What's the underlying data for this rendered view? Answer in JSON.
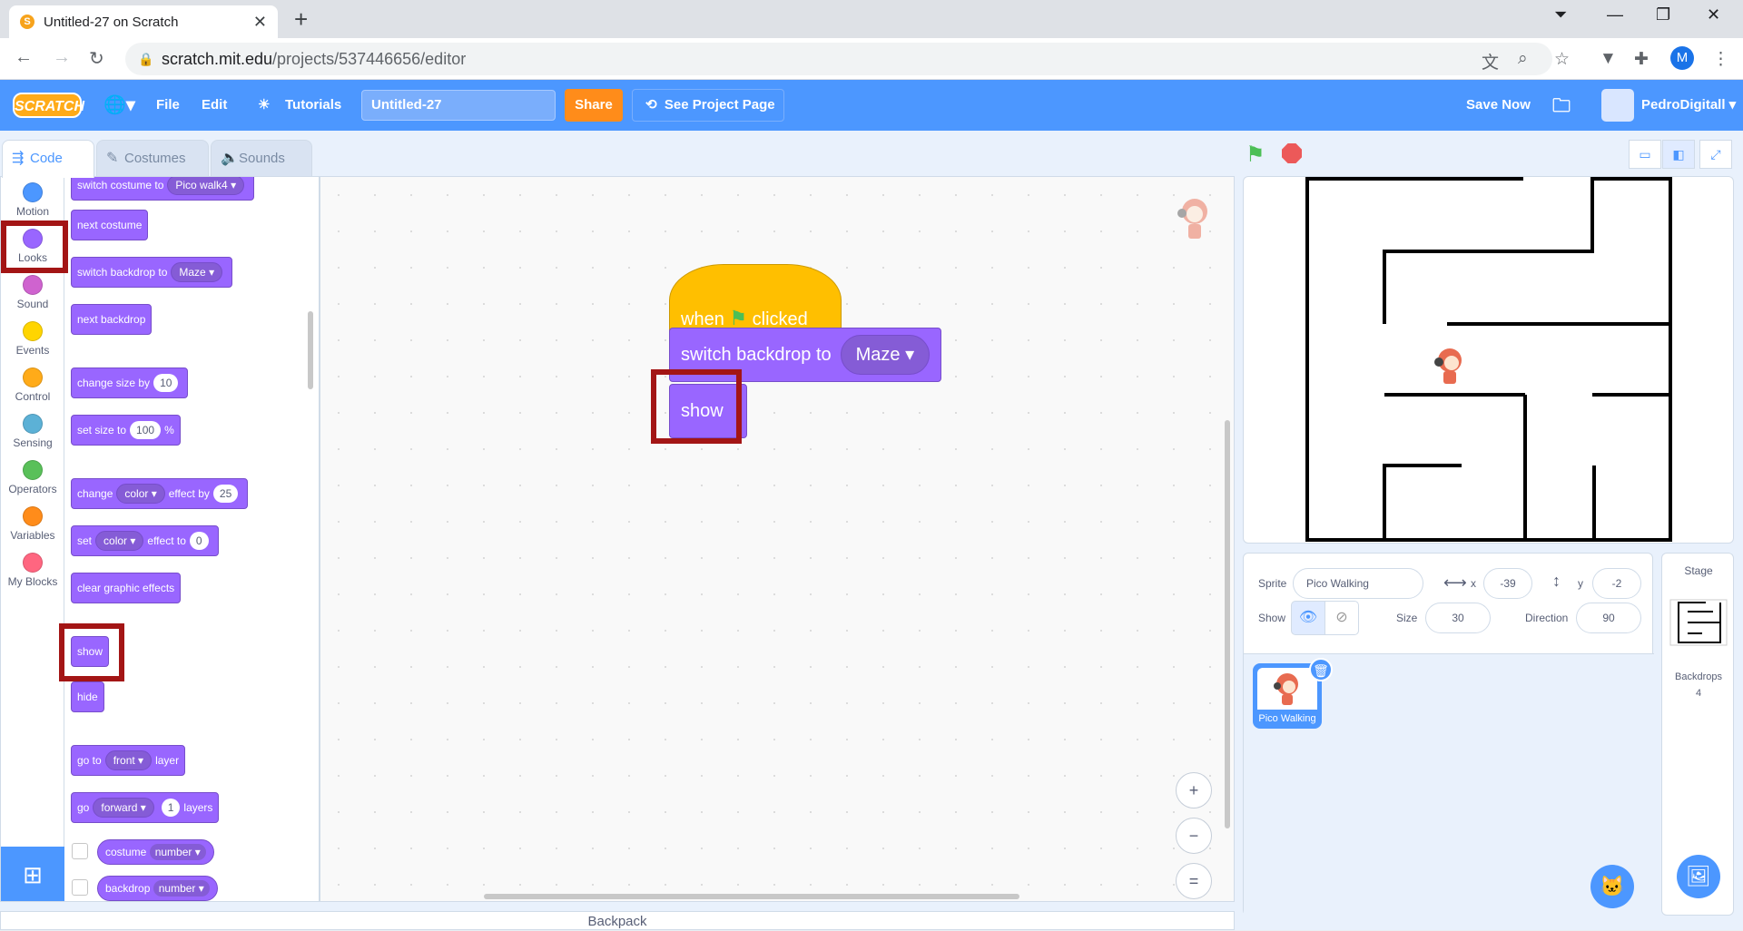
{
  "browser": {
    "tab_title": "Untitled-27 on Scratch",
    "url_host": "scratch.mit.edu",
    "url_path": "/projects/537446656/editor",
    "profile_letter": "M"
  },
  "menu": {
    "logo": "SCRATCH",
    "file": "File",
    "edit": "Edit",
    "tutorials": "Tutorials",
    "project_title": "Untitled-27",
    "share": "Share",
    "see_project": "See Project Page",
    "save_now": "Save Now",
    "username": "PedroDigitall"
  },
  "editor_tabs": [
    "Code",
    "Costumes",
    "Sounds"
  ],
  "categories": [
    {
      "label": "Motion",
      "color": "#4c97ff"
    },
    {
      "label": "Looks",
      "color": "#9966ff"
    },
    {
      "label": "Sound",
      "color": "#cf63cf"
    },
    {
      "label": "Events",
      "color": "#ffd500"
    },
    {
      "label": "Control",
      "color": "#ffab19"
    },
    {
      "label": "Sensing",
      "color": "#5cb1d6"
    },
    {
      "label": "Operators",
      "color": "#59c059"
    },
    {
      "label": "Variables",
      "color": "#ff8c1a"
    },
    {
      "label": "My Blocks",
      "color": "#ff6680"
    }
  ],
  "palette": {
    "switch_costume": "switch costume to",
    "costume_value": "Pico walk4",
    "next_costume": "next costume",
    "switch_backdrop": "switch backdrop to",
    "backdrop_value": "Maze",
    "next_backdrop": "next backdrop",
    "change_size": "change size by",
    "change_size_val": "10",
    "set_size": "set size to",
    "set_size_val": "100",
    "percent": "%",
    "change": "change",
    "effect_by": "effect by",
    "effect_val": "25",
    "set": "set",
    "effect_to": "effect to",
    "effect_to_val": "0",
    "color": "color",
    "clear_effects": "clear graphic effects",
    "show": "show",
    "hide": "hide",
    "go_to": "go to",
    "front": "front",
    "layer": "layer",
    "go": "go",
    "forward": "forward",
    "layers_val": "1",
    "layers": "layers",
    "costume": "costume",
    "number": "number",
    "backdrop": "backdrop"
  },
  "script": {
    "when": "when",
    "clicked": "clicked",
    "switch_backdrop": "switch backdrop to",
    "backdrop_value": "Maze",
    "show": "show"
  },
  "zoom": {
    "in": "+",
    "out": "−",
    "reset": "="
  },
  "backpack": "Backpack",
  "sprite_info": {
    "sprite_label": "Sprite",
    "sprite_name": "Pico Walking",
    "x_label": "x",
    "x": "-39",
    "y_label": "y",
    "y": "-2",
    "show_label": "Show",
    "size_label": "Size",
    "size": "30",
    "direction_label": "Direction",
    "direction": "90"
  },
  "sprites": [
    {
      "name": "Pico Walking"
    }
  ],
  "stage_panel": {
    "title": "Stage",
    "backdrops_label": "Backdrops",
    "backdrops_count": "4"
  },
  "colors": {
    "accent": "#4c97ff",
    "looks": "#9966ff",
    "events": "#ffbf00",
    "highlight": "#a31515"
  }
}
